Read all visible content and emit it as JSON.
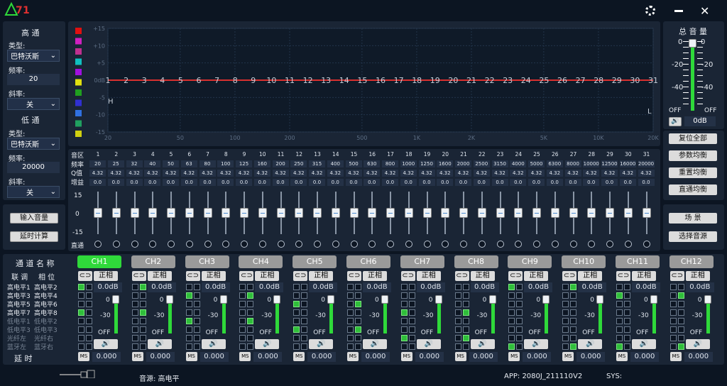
{
  "app": {
    "logo_text": "ATI",
    "icons": {
      "settings": "gear-icon",
      "minimize": "minimize-icon",
      "close": "close-icon"
    }
  },
  "highpass": {
    "title": "高 通",
    "type_label": "类型:",
    "type_value": "巴特沃斯",
    "freq_label": "频率:",
    "freq_value": "20",
    "slope_label": "斜率:",
    "slope_value": "关"
  },
  "lowpass": {
    "title": "低 通",
    "type_label": "类型:",
    "type_value": "巴特沃斯",
    "freq_label": "频率:",
    "freq_value": "20000",
    "slope_label": "斜率:",
    "slope_value": "关"
  },
  "left_buttons": {
    "input_volume": "输入音量",
    "delay_calc": "延时计算"
  },
  "graph": {
    "y_ticks": [
      "+15",
      "+10",
      "+5",
      "0dB",
      "-5",
      "-10",
      "-15"
    ],
    "x_ticks": [
      "20",
      "50",
      "100",
      "200",
      "500",
      "1K",
      "2K",
      "5K",
      "10K",
      "20K"
    ],
    "band_numbers": [
      "1",
      "2",
      "3",
      "4",
      "5",
      "6",
      "7",
      "8",
      "9",
      "10",
      "11",
      "12",
      "13",
      "14",
      "15",
      "16",
      "17",
      "18",
      "19",
      "20",
      "21",
      "22",
      "23",
      "24",
      "25",
      "26",
      "27",
      "28",
      "29",
      "30",
      "31"
    ],
    "h_marker": "H",
    "l_marker": "L",
    "legend_colors": [
      "#e01010",
      "#d020c0",
      "#c03090",
      "#10c0c0",
      "#a010e0",
      "#e0e010",
      "#20a020",
      "#3030d0",
      "#3070e0",
      "#20a060",
      "#d0d010"
    ]
  },
  "eq": {
    "row_labels": [
      "音区",
      "频率",
      "Q值",
      "增益"
    ],
    "bands": [
      "1",
      "2",
      "3",
      "4",
      "5",
      "6",
      "7",
      "8",
      "9",
      "10",
      "11",
      "12",
      "13",
      "14",
      "15",
      "16",
      "17",
      "18",
      "19",
      "20",
      "21",
      "22",
      "23",
      "24",
      "25",
      "26",
      "27",
      "28",
      "29",
      "30",
      "31"
    ],
    "freqs": [
      "20",
      "25",
      "32",
      "40",
      "50",
      "63",
      "80",
      "100",
      "125",
      "160",
      "200",
      "250",
      "315",
      "400",
      "500",
      "630",
      "800",
      "1000",
      "1250",
      "1600",
      "2000",
      "2500",
      "3150",
      "4000",
      "5000",
      "6300",
      "8000",
      "10000",
      "12500",
      "16000",
      "20000"
    ],
    "q": "4.32",
    "gain": "0.0",
    "scale_top": "15",
    "scale_mid": "0",
    "scale_bot": "-15",
    "bypass_label": "直通"
  },
  "master": {
    "title": "总 音 量",
    "top_left": "0",
    "top_right": "0",
    "m20": "-20",
    "m40": "-40",
    "off": "OFF",
    "value": "0dB",
    "ticks_right": [
      "-20",
      "-40"
    ]
  },
  "right_buttons": {
    "reset_all": "复位全部",
    "param_eq": "参数均衡",
    "reset_eq": "重置均衡",
    "bypass_eq": "直通均衡",
    "scene": "场  景",
    "select_source": "选择音源"
  },
  "routing": {
    "title": "通 道 名 称",
    "link_label": "联 调",
    "phase_label": "相 位",
    "names": [
      [
        "高电平1",
        "高电平2"
      ],
      [
        "高电平3",
        "高电平4"
      ],
      [
        "高电平5",
        "高电平6"
      ],
      [
        "高电平7",
        "高电平8"
      ],
      [
        "低电平1",
        "低电平2"
      ],
      [
        "低电平3",
        "低电平3"
      ],
      [
        "光纤左",
        "光纤右"
      ],
      [
        "蓝牙左",
        "蓝牙右"
      ]
    ],
    "delay_label": "延      时"
  },
  "channels": [
    {
      "name": "CH1",
      "gain": "0.0dB",
      "phase": "正相",
      "delay": "0.000",
      "active": true,
      "on": [
        0,
        6
      ]
    },
    {
      "name": "CH2",
      "gain": "0.0dB",
      "phase": "正相",
      "delay": "0.000",
      "active": false,
      "on": [
        1,
        7
      ]
    },
    {
      "name": "CH3",
      "gain": "0.0dB",
      "phase": "正相",
      "delay": "0.000",
      "active": false,
      "on": [
        2,
        8
      ]
    },
    {
      "name": "CH4",
      "gain": "0.0dB",
      "phase": "正相",
      "delay": "0.000",
      "active": false,
      "on": [
        3,
        9
      ]
    },
    {
      "name": "CH5",
      "gain": "0.0dB",
      "phase": "正相",
      "delay": "0.000",
      "active": false,
      "on": [
        4,
        10
      ]
    },
    {
      "name": "CH6",
      "gain": "0.0dB",
      "phase": "正相",
      "delay": "0.000",
      "active": false,
      "on": [
        5,
        11
      ]
    },
    {
      "name": "CH7",
      "gain": "0.0dB",
      "phase": "正相",
      "delay": "0.000",
      "active": false,
      "on": [
        6,
        12
      ]
    },
    {
      "name": "CH8",
      "gain": "0.0dB",
      "phase": "正相",
      "delay": "0.000",
      "active": false,
      "on": [
        7,
        13
      ]
    },
    {
      "name": "CH9",
      "gain": "0.0dB",
      "phase": "正相",
      "delay": "0.000",
      "active": false,
      "on": [
        0,
        14
      ]
    },
    {
      "name": "CH10",
      "gain": "0.0dB",
      "phase": "正相",
      "delay": "0.000",
      "active": false,
      "on": [
        1,
        15
      ]
    },
    {
      "name": "CH11",
      "gain": "0.0dB",
      "phase": "正相",
      "delay": "0.000",
      "active": false,
      "on": [
        2,
        14
      ]
    },
    {
      "name": "CH12",
      "gain": "0.0dB",
      "phase": "正相",
      "delay": "0.000",
      "active": false,
      "on": [
        3,
        15
      ]
    }
  ],
  "channel_labels": {
    "zero": "0",
    "m30": "-30",
    "off": "OFF",
    "ms": "MS",
    "link_icon": "link-icon",
    "speaker_icon": "speaker-icon"
  },
  "status": {
    "source_label": "音源: 高电平",
    "app_version": "APP: 2080J_211110V2",
    "sys": "SYS:",
    "usb_icon": "usb-icon"
  }
}
